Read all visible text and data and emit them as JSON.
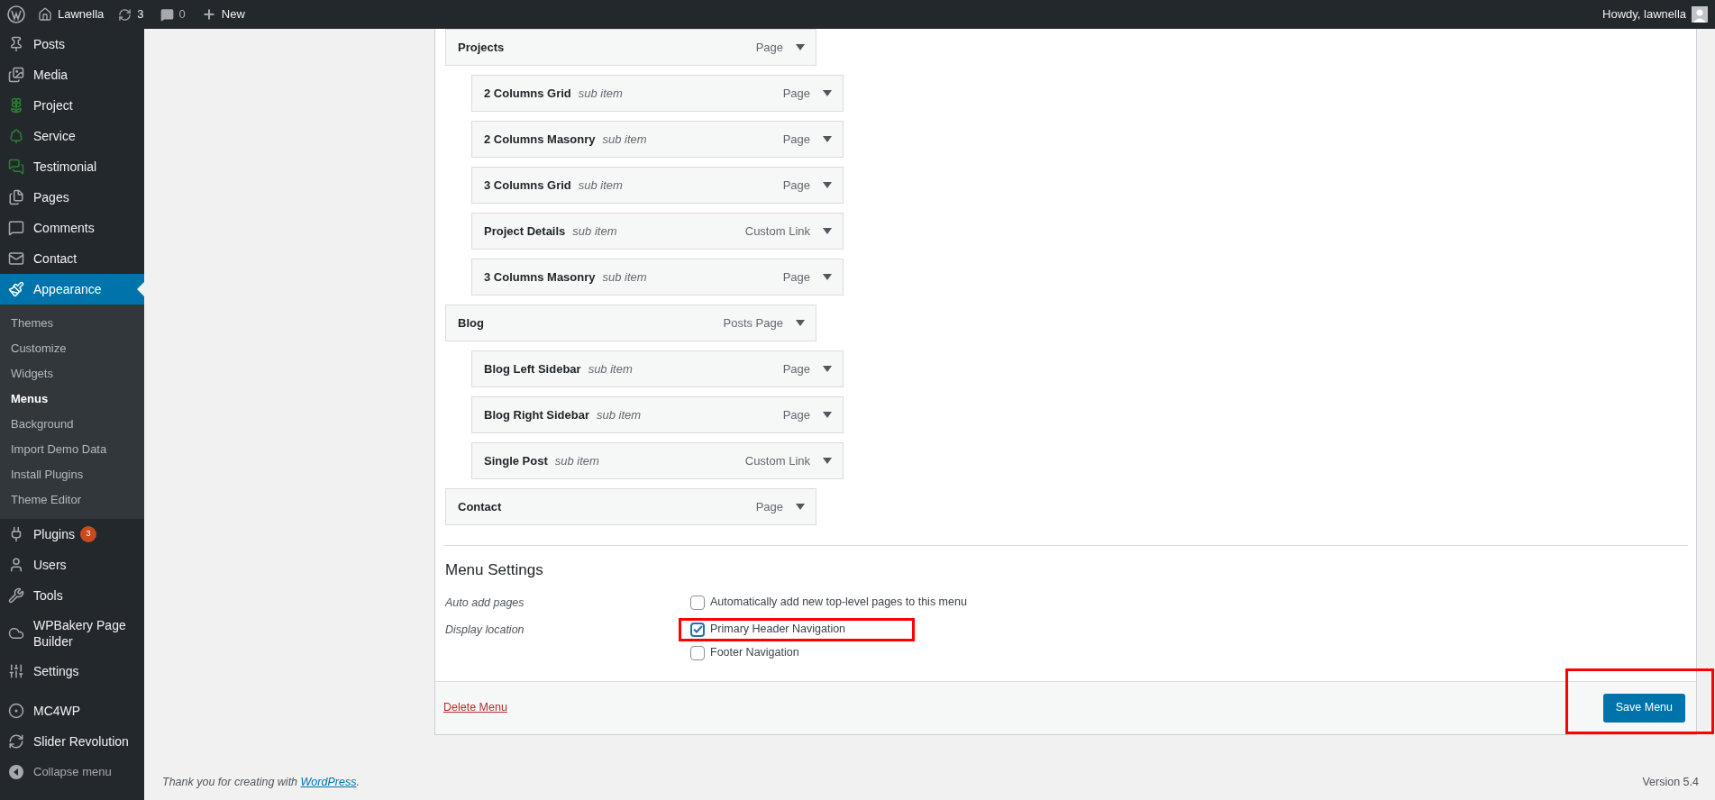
{
  "top_bar": {
    "site": "Lawnella",
    "updates": "3",
    "comments": "0",
    "new": "New",
    "greeting": "Howdy, lawnella"
  },
  "sidebar": {
    "items": [
      {
        "label": "Posts",
        "selected": false
      },
      {
        "label": "Media",
        "selected": false
      },
      {
        "label": "Project",
        "selected": false
      },
      {
        "label": "Service",
        "selected": false
      },
      {
        "label": "Testimonial",
        "selected": false
      },
      {
        "label": "Pages",
        "selected": false
      },
      {
        "label": "Comments",
        "selected": false
      },
      {
        "label": "Contact",
        "selected": false
      },
      {
        "label": "Appearance",
        "selected": true,
        "children": [
          {
            "label": "Themes",
            "selected": false
          },
          {
            "label": "Customize",
            "selected": false
          },
          {
            "label": "Widgets",
            "selected": false
          },
          {
            "label": "Menus",
            "selected": true
          },
          {
            "label": "Background",
            "selected": false
          },
          {
            "label": "Import Demo Data",
            "selected": false
          },
          {
            "label": "Install Plugins",
            "selected": false
          },
          {
            "label": "Theme Editor",
            "selected": false
          }
        ]
      },
      {
        "label": "Plugins",
        "selected": false,
        "badge": "3"
      },
      {
        "label": "Users",
        "selected": false
      },
      {
        "label": "Tools",
        "selected": false
      },
      {
        "label": "WPBakery Page Builder",
        "selected": false
      },
      {
        "label": "Settings",
        "selected": false
      },
      {
        "label": "MC4WP",
        "selected": false
      },
      {
        "label": "Slider Revolution",
        "selected": false
      }
    ],
    "collapse": "Collapse menu"
  },
  "menu_items": [
    {
      "title": "Projects",
      "type": "Page",
      "children": [
        {
          "title": "2 Columns Grid",
          "note": "sub item",
          "type": "Page"
        },
        {
          "title": "2 Columns Masonry",
          "note": "sub item",
          "type": "Page"
        },
        {
          "title": "3 Columns Grid",
          "note": "sub item",
          "type": "Page"
        },
        {
          "title": "Project Details",
          "note": "sub item",
          "type": "Custom Link"
        },
        {
          "title": "3 Columns Masonry",
          "note": "sub item",
          "type": "Page"
        }
      ]
    },
    {
      "title": "Blog",
      "type": "Posts Page",
      "children": [
        {
          "title": "Blog Left Sidebar",
          "note": "sub item",
          "type": "Page"
        },
        {
          "title": "Blog Right Sidebar",
          "note": "sub item",
          "type": "Page"
        },
        {
          "title": "Single Post",
          "note": "sub item",
          "type": "Custom Link"
        }
      ]
    },
    {
      "title": "Contact",
      "type": "Page"
    }
  ],
  "menu_settings": {
    "title": "Menu Settings",
    "rows": [
      {
        "label": "Auto add pages",
        "options": [
          {
            "label": "Automatically add new top-level pages to this menu",
            "checked": false,
            "highlighted": false
          }
        ]
      },
      {
        "label": "Display location",
        "options": [
          {
            "label": "Primary Header Navigation",
            "checked": true,
            "highlighted": true
          },
          {
            "label": "Footer Navigation",
            "checked": false,
            "highlighted": false
          }
        ]
      }
    ]
  },
  "delete_link": "Delete Menu",
  "save_button": {
    "label": "Save Menu",
    "highlighted": true
  },
  "footer": {
    "text": "Thank you for creating with",
    "link": "WordPress",
    "after": ".",
    "version": "Version 5.4"
  }
}
